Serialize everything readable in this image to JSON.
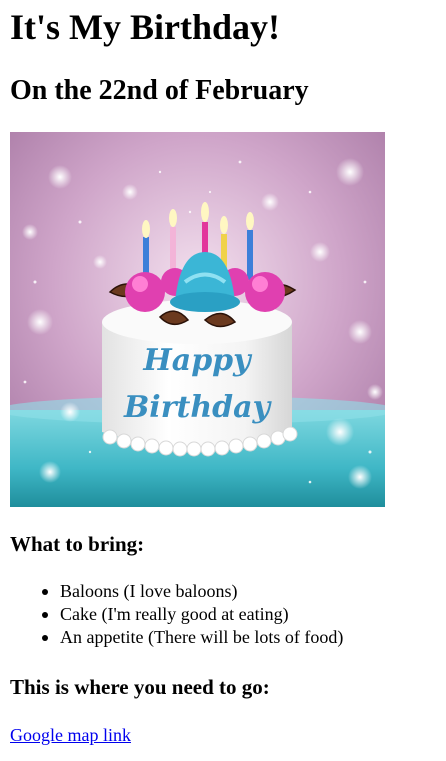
{
  "page": {
    "title": "It's My Birthday!",
    "subtitle": "On the 22nd of February"
  },
  "image": {
    "icon": "birthday-cake-image",
    "cake_text_line1": "Happy",
    "cake_text_line2": "Birthday",
    "colors": {
      "background": "#c89cc0",
      "table": "#4fc3cf",
      "cake": "#f5f5f5",
      "frosting": "#e040b0",
      "topping": "#3bb6d6",
      "text": "#3a8fc0"
    }
  },
  "bring": {
    "heading": "What to bring:",
    "items": [
      "Baloons (I love baloons)",
      "Cake (I'm really good at eating)",
      "An appetite (There will be lots of food)"
    ]
  },
  "directions": {
    "heading": "This is where you need to go:",
    "link_text": "Google map link"
  },
  "colors": {
    "link": "#0000ee"
  }
}
